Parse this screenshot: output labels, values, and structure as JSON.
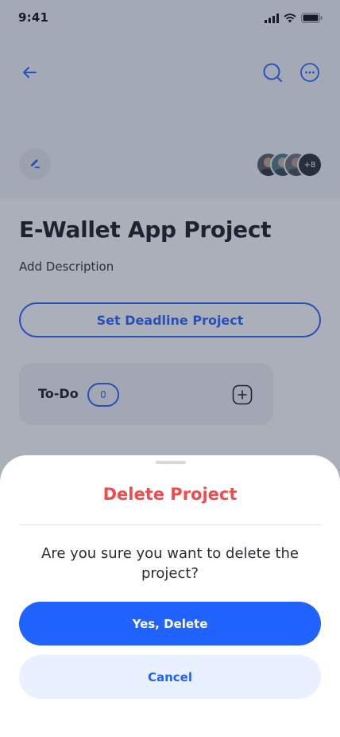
{
  "status_bar": {
    "time": "9:41"
  },
  "header": {
    "icons": [
      "arrow-left-icon",
      "search-icon",
      "more-icon",
      "edit-icon"
    ],
    "members_more": "+8"
  },
  "project": {
    "title": "E-Wallet App Project",
    "description_placeholder": "Add Description",
    "deadline_button": "Set Deadline Project"
  },
  "todo": {
    "label": "To-Do",
    "count": "0"
  },
  "sheet": {
    "title": "Delete Project",
    "message": "Are you sure you want to delete the project?",
    "confirm_label": "Yes, Delete",
    "cancel_label": "Cancel"
  },
  "colors": {
    "accent": "#2163ff",
    "danger": "#f24b4b",
    "overlay": "rgba(33,44,70,0.38)"
  }
}
